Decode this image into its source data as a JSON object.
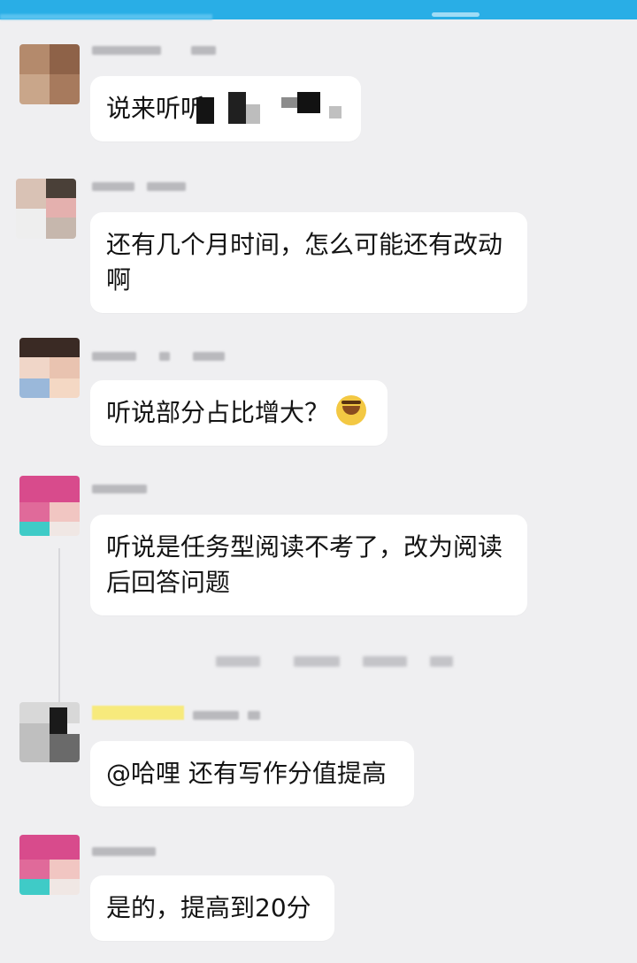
{
  "messages": [
    {
      "text": "说来听听"
    },
    {
      "text": "还有几个月时间，怎么可能还有改动啊"
    },
    {
      "text": "听说部分占比增大？"
    },
    {
      "text": "听说是任务型阅读不考了，改为阅读后回答问题"
    },
    {
      "text": "@哈哩 还有写作分值提高"
    },
    {
      "text": "是的，提高到20分"
    }
  ],
  "colors": {
    "top_bar": "#29aee6",
    "background": "#efeff1",
    "bubble": "#ffffff"
  },
  "icons": {
    "emoji": "laughing-face-emoji"
  }
}
